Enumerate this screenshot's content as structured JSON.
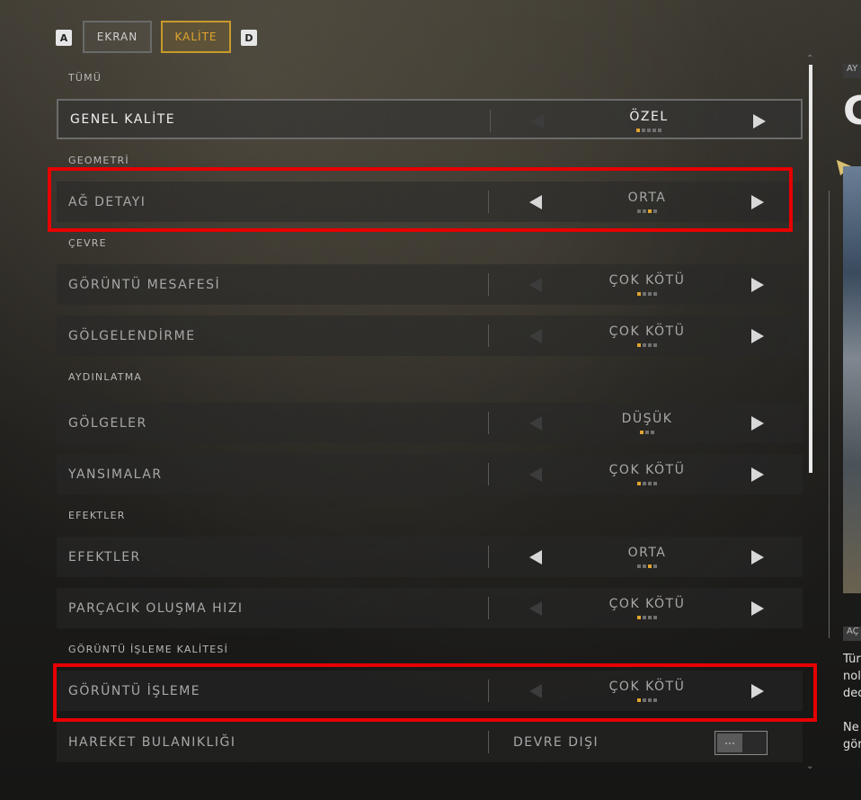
{
  "tabs": {
    "key_left": "A",
    "key_right": "D",
    "ekran": "EKRAN",
    "kalite": "KALİTE"
  },
  "sections": {
    "tumu": "TÜMÜ",
    "geometri": "GEOMETRİ",
    "cevre": "ÇEVRE",
    "aydinlatma": "AYDINLATMA",
    "efektler": "EFEKTLER",
    "goruntu_isleme_kalitesi": "GÖRÜNTÜ İŞLEME KALİTESİ"
  },
  "settings": {
    "genel_kalite": {
      "label": "GENEL KALİTE",
      "value": "ÖZEL",
      "level": 1,
      "steps": 5
    },
    "ag_detayi": {
      "label": "AĞ DETAYI",
      "value": "ORTA",
      "level": 3,
      "steps": 4
    },
    "goruntu_mesafesi": {
      "label": "GÖRÜNTÜ MESAFESİ",
      "value": "ÇOK KÖTÜ",
      "level": 1,
      "steps": 4
    },
    "golgelendirme": {
      "label": "GÖLGELENDİRME",
      "value": "ÇOK KÖTÜ",
      "level": 1,
      "steps": 4
    },
    "golgeler": {
      "label": "GÖLGELER",
      "value": "DÜŞÜK",
      "level": 1,
      "steps": 3
    },
    "yansimalar": {
      "label": "YANSIMALAR",
      "value": "ÇOK KÖTÜ",
      "level": 1,
      "steps": 4
    },
    "efektler": {
      "label": "EFEKTLER",
      "value": "ORTA",
      "level": 3,
      "steps": 4
    },
    "parcacik": {
      "label": "PARÇACIK OLUŞMA HIZI",
      "value": "ÇOK KÖTÜ",
      "level": 1,
      "steps": 4
    },
    "goruntu_isleme": {
      "label": "GÖRÜNTÜ İŞLEME",
      "value": "ÇOK KÖTÜ",
      "level": 1,
      "steps": 4
    },
    "hareket_bulanikligi": {
      "label": "HAREKET BULANIKLIĞI",
      "value": "DEVRE DIŞI",
      "enabled": false
    }
  },
  "right_panel": {
    "tag_top": "AY",
    "title_fragment": "G",
    "tag_bottom": "AÇ",
    "text_lines": [
      "Tür",
      "nol",
      "dec",
      "Ne",
      "gör"
    ]
  },
  "colors": {
    "accent": "#e0a530",
    "highlight": "#e60000"
  }
}
